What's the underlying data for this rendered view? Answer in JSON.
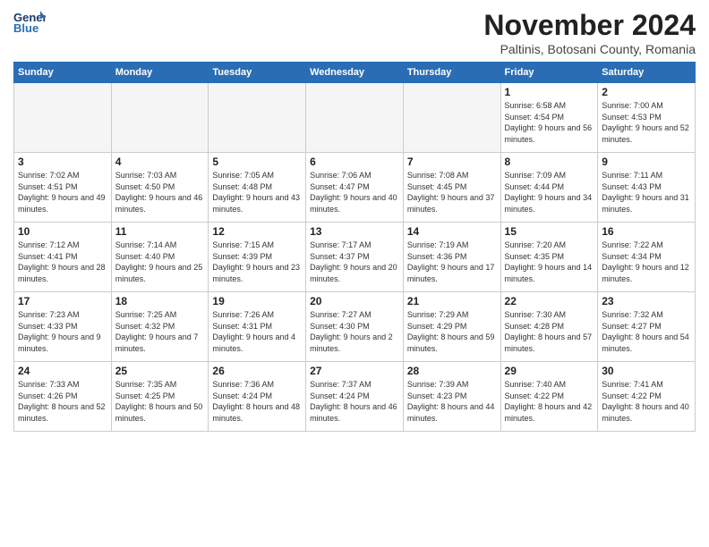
{
  "header": {
    "logo_line1": "General",
    "logo_line2": "Blue",
    "month": "November 2024",
    "location": "Paltinis, Botosani County, Romania"
  },
  "days_of_week": [
    "Sunday",
    "Monday",
    "Tuesday",
    "Wednesday",
    "Thursday",
    "Friday",
    "Saturday"
  ],
  "weeks": [
    [
      {
        "day": "",
        "info": ""
      },
      {
        "day": "",
        "info": ""
      },
      {
        "day": "",
        "info": ""
      },
      {
        "day": "",
        "info": ""
      },
      {
        "day": "",
        "info": ""
      },
      {
        "day": "1",
        "info": "Sunrise: 6:58 AM\nSunset: 4:54 PM\nDaylight: 9 hours and 56 minutes."
      },
      {
        "day": "2",
        "info": "Sunrise: 7:00 AM\nSunset: 4:53 PM\nDaylight: 9 hours and 52 minutes."
      }
    ],
    [
      {
        "day": "3",
        "info": "Sunrise: 7:02 AM\nSunset: 4:51 PM\nDaylight: 9 hours and 49 minutes."
      },
      {
        "day": "4",
        "info": "Sunrise: 7:03 AM\nSunset: 4:50 PM\nDaylight: 9 hours and 46 minutes."
      },
      {
        "day": "5",
        "info": "Sunrise: 7:05 AM\nSunset: 4:48 PM\nDaylight: 9 hours and 43 minutes."
      },
      {
        "day": "6",
        "info": "Sunrise: 7:06 AM\nSunset: 4:47 PM\nDaylight: 9 hours and 40 minutes."
      },
      {
        "day": "7",
        "info": "Sunrise: 7:08 AM\nSunset: 4:45 PM\nDaylight: 9 hours and 37 minutes."
      },
      {
        "day": "8",
        "info": "Sunrise: 7:09 AM\nSunset: 4:44 PM\nDaylight: 9 hours and 34 minutes."
      },
      {
        "day": "9",
        "info": "Sunrise: 7:11 AM\nSunset: 4:43 PM\nDaylight: 9 hours and 31 minutes."
      }
    ],
    [
      {
        "day": "10",
        "info": "Sunrise: 7:12 AM\nSunset: 4:41 PM\nDaylight: 9 hours and 28 minutes."
      },
      {
        "day": "11",
        "info": "Sunrise: 7:14 AM\nSunset: 4:40 PM\nDaylight: 9 hours and 25 minutes."
      },
      {
        "day": "12",
        "info": "Sunrise: 7:15 AM\nSunset: 4:39 PM\nDaylight: 9 hours and 23 minutes."
      },
      {
        "day": "13",
        "info": "Sunrise: 7:17 AM\nSunset: 4:37 PM\nDaylight: 9 hours and 20 minutes."
      },
      {
        "day": "14",
        "info": "Sunrise: 7:19 AM\nSunset: 4:36 PM\nDaylight: 9 hours and 17 minutes."
      },
      {
        "day": "15",
        "info": "Sunrise: 7:20 AM\nSunset: 4:35 PM\nDaylight: 9 hours and 14 minutes."
      },
      {
        "day": "16",
        "info": "Sunrise: 7:22 AM\nSunset: 4:34 PM\nDaylight: 9 hours and 12 minutes."
      }
    ],
    [
      {
        "day": "17",
        "info": "Sunrise: 7:23 AM\nSunset: 4:33 PM\nDaylight: 9 hours and 9 minutes."
      },
      {
        "day": "18",
        "info": "Sunrise: 7:25 AM\nSunset: 4:32 PM\nDaylight: 9 hours and 7 minutes."
      },
      {
        "day": "19",
        "info": "Sunrise: 7:26 AM\nSunset: 4:31 PM\nDaylight: 9 hours and 4 minutes."
      },
      {
        "day": "20",
        "info": "Sunrise: 7:27 AM\nSunset: 4:30 PM\nDaylight: 9 hours and 2 minutes."
      },
      {
        "day": "21",
        "info": "Sunrise: 7:29 AM\nSunset: 4:29 PM\nDaylight: 8 hours and 59 minutes."
      },
      {
        "day": "22",
        "info": "Sunrise: 7:30 AM\nSunset: 4:28 PM\nDaylight: 8 hours and 57 minutes."
      },
      {
        "day": "23",
        "info": "Sunrise: 7:32 AM\nSunset: 4:27 PM\nDaylight: 8 hours and 54 minutes."
      }
    ],
    [
      {
        "day": "24",
        "info": "Sunrise: 7:33 AM\nSunset: 4:26 PM\nDaylight: 8 hours and 52 minutes."
      },
      {
        "day": "25",
        "info": "Sunrise: 7:35 AM\nSunset: 4:25 PM\nDaylight: 8 hours and 50 minutes."
      },
      {
        "day": "26",
        "info": "Sunrise: 7:36 AM\nSunset: 4:24 PM\nDaylight: 8 hours and 48 minutes."
      },
      {
        "day": "27",
        "info": "Sunrise: 7:37 AM\nSunset: 4:24 PM\nDaylight: 8 hours and 46 minutes."
      },
      {
        "day": "28",
        "info": "Sunrise: 7:39 AM\nSunset: 4:23 PM\nDaylight: 8 hours and 44 minutes."
      },
      {
        "day": "29",
        "info": "Sunrise: 7:40 AM\nSunset: 4:22 PM\nDaylight: 8 hours and 42 minutes."
      },
      {
        "day": "30",
        "info": "Sunrise: 7:41 AM\nSunset: 4:22 PM\nDaylight: 8 hours and 40 minutes."
      }
    ]
  ]
}
